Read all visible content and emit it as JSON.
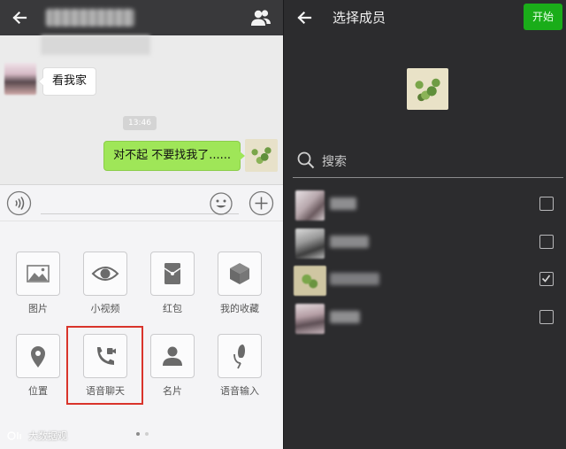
{
  "left": {
    "messages": [
      {
        "from": "other",
        "text": "看我家"
      },
      {
        "type": "time",
        "text": "13:46"
      },
      {
        "from": "me",
        "text": "对不起  不要找我了......"
      }
    ],
    "features": [
      {
        "label": "图片",
        "icon": "photo-icon"
      },
      {
        "label": "小视频",
        "icon": "eye-icon"
      },
      {
        "label": "红包",
        "icon": "red-packet-icon"
      },
      {
        "label": "我的收藏",
        "icon": "cube-icon"
      },
      {
        "label": "位置",
        "icon": "location-pin-icon"
      },
      {
        "label": "语音聊天",
        "icon": "phone-video-icon"
      },
      {
        "label": "名片",
        "icon": "person-card-icon"
      },
      {
        "label": "语音输入",
        "icon": "microphone-icon"
      }
    ],
    "watermark": "大数据观"
  },
  "right": {
    "title": "选择成员",
    "start_button": "开始",
    "search_placeholder": "搜索",
    "members": [
      {
        "checked": false
      },
      {
        "checked": false
      },
      {
        "checked": true
      },
      {
        "checked": false
      }
    ]
  },
  "colors": {
    "topbar": "#39393b",
    "chat_bg": "#ebebeb",
    "sent_bubble": "#9fe658",
    "right_bg": "#2c2c2e",
    "start_green": "#1aad19",
    "highlight_red": "#d9342b"
  }
}
